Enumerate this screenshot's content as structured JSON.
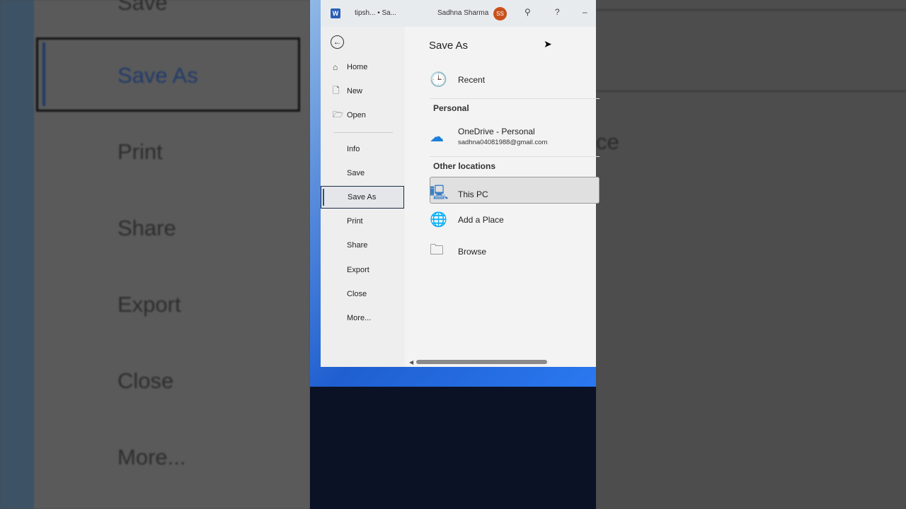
{
  "background_left": {
    "items": [
      "Save",
      "Save As",
      "Print",
      "Share",
      "Export",
      "Close",
      "More..."
    ]
  },
  "background_right": {
    "text": "ce"
  },
  "titlebar": {
    "app_icon": "W",
    "document": "tipsh... • Sa...",
    "user_name": "Sadhna Sharma",
    "avatar_initials": "SS",
    "help": "?",
    "minimize": "–"
  },
  "nav": {
    "items": [
      {
        "label": "Home",
        "icon": "⌂"
      },
      {
        "label": "New",
        "icon": "🗋"
      },
      {
        "label": "Open",
        "icon": "🗁"
      },
      {
        "label": "Info"
      },
      {
        "label": "Save"
      },
      {
        "label": "Save As"
      },
      {
        "label": "Print"
      },
      {
        "label": "Share"
      },
      {
        "label": "Export"
      },
      {
        "label": "Close"
      },
      {
        "label": "More..."
      }
    ]
  },
  "main": {
    "title": "Save As",
    "recent": "Recent",
    "personal_header": "Personal",
    "onedrive": {
      "name": "OneDrive - Personal",
      "email": "sadhna04081988@gmail.com"
    },
    "other_header": "Other locations",
    "this_pc": "This PC",
    "add_place": "Add a Place",
    "browse": "Browse"
  },
  "colors": {
    "accent": "#2a4f8f",
    "avatar": "#c9501c",
    "onedrive": "#1e7fd8"
  }
}
